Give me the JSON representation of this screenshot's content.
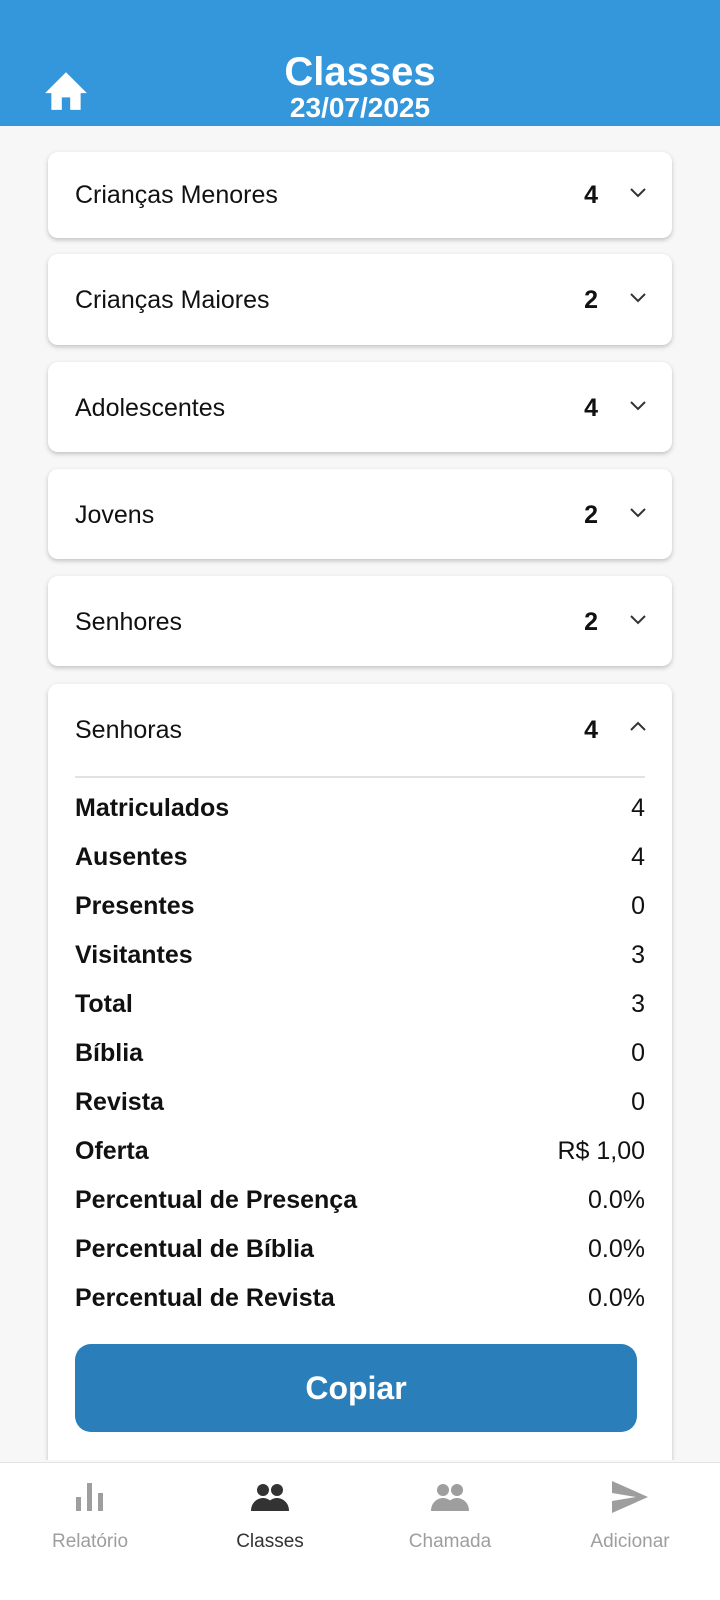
{
  "header": {
    "title": "Classes",
    "date": "23/07/2025",
    "home_icon": "home-icon",
    "background_color": "#3597db"
  },
  "classes": [
    {
      "label": "Crianças Menores",
      "count": "4",
      "expanded": false
    },
    {
      "label": "Crianças Maiores",
      "count": "2",
      "expanded": false
    },
    {
      "label": "Adolescentes",
      "count": "4",
      "expanded": false
    },
    {
      "label": "Jovens",
      "count": "2",
      "expanded": false
    },
    {
      "label": "Senhores",
      "count": "2",
      "expanded": false
    },
    {
      "label": "Senhoras",
      "count": "4",
      "expanded": true
    }
  ],
  "details": [
    {
      "label": "Matriculados",
      "value": "4"
    },
    {
      "label": "Ausentes",
      "value": "4"
    },
    {
      "label": "Presentes",
      "value": "0"
    },
    {
      "label": "Visitantes",
      "value": "3"
    },
    {
      "label": "Total",
      "value": "3"
    },
    {
      "label": "Bíblia",
      "value": "0"
    },
    {
      "label": "Revista",
      "value": "0"
    },
    {
      "label": "Oferta",
      "value": "R$ 1,00"
    },
    {
      "label": "Percentual de Presença",
      "value": "0.0%"
    },
    {
      "label": "Percentual de Bíblia",
      "value": "0.0%"
    },
    {
      "label": "Percentual de Revista",
      "value": "0.0%"
    }
  ],
  "copy_button": {
    "label": "Copiar",
    "color": "#2a7fba"
  },
  "nav": [
    {
      "label": "Relatório",
      "icon": "bar-chart-icon",
      "active": false
    },
    {
      "label": "Classes",
      "icon": "group-icon",
      "active": true
    },
    {
      "label": "Chamada",
      "icon": "group-icon",
      "active": false
    },
    {
      "label": "Adicionar",
      "icon": "send-icon",
      "active": false
    }
  ]
}
